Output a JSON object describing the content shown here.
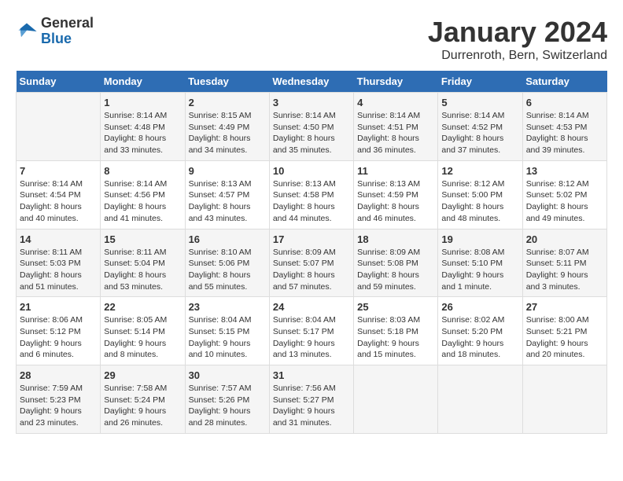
{
  "logo": {
    "general": "General",
    "blue": "Blue"
  },
  "title": "January 2024",
  "subtitle": "Durrenroth, Bern, Switzerland",
  "days_header": [
    "Sunday",
    "Monday",
    "Tuesday",
    "Wednesday",
    "Thursday",
    "Friday",
    "Saturday"
  ],
  "weeks": [
    [
      {
        "day": "",
        "content": ""
      },
      {
        "day": "1",
        "content": "Sunrise: 8:14 AM\nSunset: 4:48 PM\nDaylight: 8 hours\nand 33 minutes."
      },
      {
        "day": "2",
        "content": "Sunrise: 8:15 AM\nSunset: 4:49 PM\nDaylight: 8 hours\nand 34 minutes."
      },
      {
        "day": "3",
        "content": "Sunrise: 8:14 AM\nSunset: 4:50 PM\nDaylight: 8 hours\nand 35 minutes."
      },
      {
        "day": "4",
        "content": "Sunrise: 8:14 AM\nSunset: 4:51 PM\nDaylight: 8 hours\nand 36 minutes."
      },
      {
        "day": "5",
        "content": "Sunrise: 8:14 AM\nSunset: 4:52 PM\nDaylight: 8 hours\nand 37 minutes."
      },
      {
        "day": "6",
        "content": "Sunrise: 8:14 AM\nSunset: 4:53 PM\nDaylight: 8 hours\nand 39 minutes."
      }
    ],
    [
      {
        "day": "7",
        "content": "Sunrise: 8:14 AM\nSunset: 4:54 PM\nDaylight: 8 hours\nand 40 minutes."
      },
      {
        "day": "8",
        "content": "Sunrise: 8:14 AM\nSunset: 4:56 PM\nDaylight: 8 hours\nand 41 minutes."
      },
      {
        "day": "9",
        "content": "Sunrise: 8:13 AM\nSunset: 4:57 PM\nDaylight: 8 hours\nand 43 minutes."
      },
      {
        "day": "10",
        "content": "Sunrise: 8:13 AM\nSunset: 4:58 PM\nDaylight: 8 hours\nand 44 minutes."
      },
      {
        "day": "11",
        "content": "Sunrise: 8:13 AM\nSunset: 4:59 PM\nDaylight: 8 hours\nand 46 minutes."
      },
      {
        "day": "12",
        "content": "Sunrise: 8:12 AM\nSunset: 5:00 PM\nDaylight: 8 hours\nand 48 minutes."
      },
      {
        "day": "13",
        "content": "Sunrise: 8:12 AM\nSunset: 5:02 PM\nDaylight: 8 hours\nand 49 minutes."
      }
    ],
    [
      {
        "day": "14",
        "content": "Sunrise: 8:11 AM\nSunset: 5:03 PM\nDaylight: 8 hours\nand 51 minutes."
      },
      {
        "day": "15",
        "content": "Sunrise: 8:11 AM\nSunset: 5:04 PM\nDaylight: 8 hours\nand 53 minutes."
      },
      {
        "day": "16",
        "content": "Sunrise: 8:10 AM\nSunset: 5:06 PM\nDaylight: 8 hours\nand 55 minutes."
      },
      {
        "day": "17",
        "content": "Sunrise: 8:09 AM\nSunset: 5:07 PM\nDaylight: 8 hours\nand 57 minutes."
      },
      {
        "day": "18",
        "content": "Sunrise: 8:09 AM\nSunset: 5:08 PM\nDaylight: 8 hours\nand 59 minutes."
      },
      {
        "day": "19",
        "content": "Sunrise: 8:08 AM\nSunset: 5:10 PM\nDaylight: 9 hours\nand 1 minute."
      },
      {
        "day": "20",
        "content": "Sunrise: 8:07 AM\nSunset: 5:11 PM\nDaylight: 9 hours\nand 3 minutes."
      }
    ],
    [
      {
        "day": "21",
        "content": "Sunrise: 8:06 AM\nSunset: 5:12 PM\nDaylight: 9 hours\nand 6 minutes."
      },
      {
        "day": "22",
        "content": "Sunrise: 8:05 AM\nSunset: 5:14 PM\nDaylight: 9 hours\nand 8 minutes."
      },
      {
        "day": "23",
        "content": "Sunrise: 8:04 AM\nSunset: 5:15 PM\nDaylight: 9 hours\nand 10 minutes."
      },
      {
        "day": "24",
        "content": "Sunrise: 8:04 AM\nSunset: 5:17 PM\nDaylight: 9 hours\nand 13 minutes."
      },
      {
        "day": "25",
        "content": "Sunrise: 8:03 AM\nSunset: 5:18 PM\nDaylight: 9 hours\nand 15 minutes."
      },
      {
        "day": "26",
        "content": "Sunrise: 8:02 AM\nSunset: 5:20 PM\nDaylight: 9 hours\nand 18 minutes."
      },
      {
        "day": "27",
        "content": "Sunrise: 8:00 AM\nSunset: 5:21 PM\nDaylight: 9 hours\nand 20 minutes."
      }
    ],
    [
      {
        "day": "28",
        "content": "Sunrise: 7:59 AM\nSunset: 5:23 PM\nDaylight: 9 hours\nand 23 minutes."
      },
      {
        "day": "29",
        "content": "Sunrise: 7:58 AM\nSunset: 5:24 PM\nDaylight: 9 hours\nand 26 minutes."
      },
      {
        "day": "30",
        "content": "Sunrise: 7:57 AM\nSunset: 5:26 PM\nDaylight: 9 hours\nand 28 minutes."
      },
      {
        "day": "31",
        "content": "Sunrise: 7:56 AM\nSunset: 5:27 PM\nDaylight: 9 hours\nand 31 minutes."
      },
      {
        "day": "",
        "content": ""
      },
      {
        "day": "",
        "content": ""
      },
      {
        "day": "",
        "content": ""
      }
    ]
  ]
}
